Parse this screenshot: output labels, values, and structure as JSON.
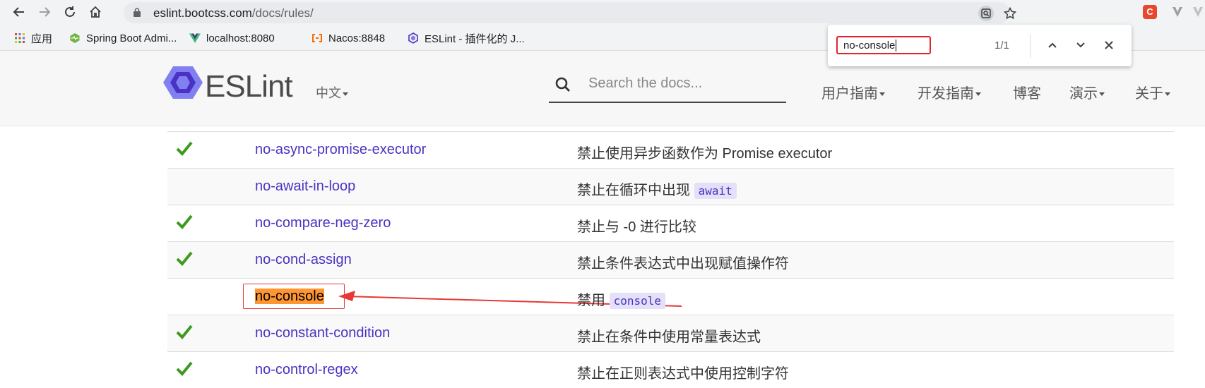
{
  "browser": {
    "url_host": "eslint.bootcss.com",
    "url_path": "/docs/rules/",
    "bookmarks": [
      {
        "label": "应用",
        "icon": "apps-grid-icon"
      },
      {
        "label": "Spring Boot Admi...",
        "icon": "spring-boot-admin-icon"
      },
      {
        "label": "localhost:8080",
        "icon": "vue-icon"
      },
      {
        "label": "Nacos:8848",
        "icon": "nacos-icon"
      },
      {
        "label": "ESLint - 插件化的 J...",
        "icon": "eslint-icon"
      }
    ],
    "find": {
      "query": "no-console",
      "count": "1/1"
    }
  },
  "header": {
    "brand": "ESLint",
    "language": "中文",
    "search_placeholder": "Search the docs...",
    "nav": [
      "用户指南",
      "开发指南",
      "博客",
      "演示",
      "关于"
    ]
  },
  "rules": [
    {
      "recommended": true,
      "name": "no-async-promise-executor",
      "desc": "禁止使用异步函数作为 Promise executor",
      "code": ""
    },
    {
      "recommended": false,
      "name": "no-await-in-loop",
      "desc": "禁止在循环中出现 ",
      "code": "await"
    },
    {
      "recommended": true,
      "name": "no-compare-neg-zero",
      "desc": "禁止与 -0 进行比较",
      "code": ""
    },
    {
      "recommended": true,
      "name": "no-cond-assign",
      "desc": "禁止条件表达式中出现赋值操作符",
      "code": ""
    },
    {
      "recommended": false,
      "name": "no-console",
      "desc": "禁用 ",
      "code": "console"
    },
    {
      "recommended": true,
      "name": "no-constant-condition",
      "desc": "禁止在条件中使用常量表达式",
      "code": ""
    },
    {
      "recommended": true,
      "name": "no-control-regex",
      "desc": "禁止在正则表达式中使用控制字符",
      "code": ""
    }
  ],
  "colors": {
    "link": "#4b32c3",
    "check": "#3c9a1e",
    "find_highlight": "#ff9632",
    "annotation_red": "#e53935"
  }
}
